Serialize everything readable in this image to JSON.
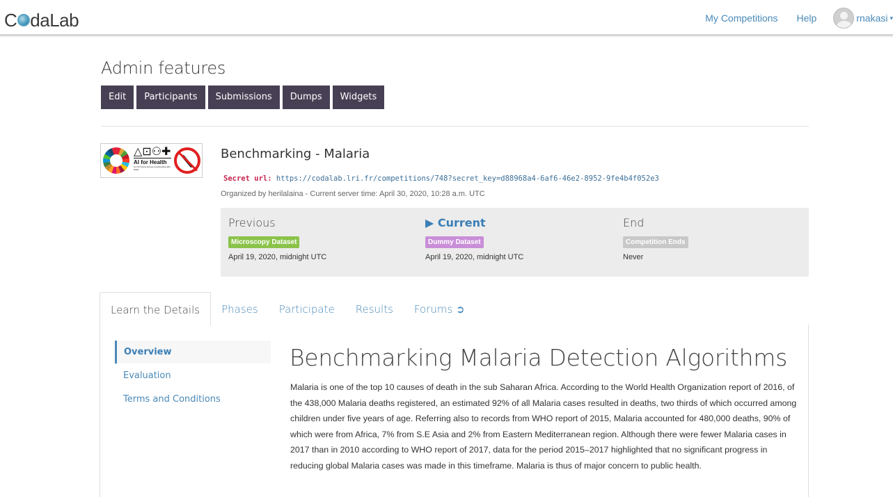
{
  "navbar": {
    "logo_text_1": "C",
    "logo_text_2": "daLab",
    "my_competitions": "My Competitions",
    "help": "Help",
    "username": "rnakasi",
    "caret": "▾"
  },
  "admin": {
    "title": "Admin features",
    "buttons": [
      "Edit",
      "Participants",
      "Submissions",
      "Dumps",
      "Widgets"
    ]
  },
  "competition": {
    "logo": {
      "ai_shapes": "△⊡⚇✚",
      "ai_title": "AI for Health",
      "ai_sub": "An ITU Focus Group in partnership with WHO"
    },
    "title": "Benchmarking - Malaria",
    "secret_label": "Secret url:",
    "secret_url": "https://codalab.lri.fr/competitions/748?secret_key=d88968a4-6af6-46e2-8952-9fe4b4f052e3",
    "organized": "Organized by herilalaina - Current server time: April 30, 2020, 10:28 a.m. UTC"
  },
  "phases": [
    {
      "name": "Previous",
      "badge": "Microscopy Dataset",
      "badge_color": "#8bc34a",
      "date": "April 19, 2020, midnight UTC"
    },
    {
      "name": "▶ Current",
      "badge": "Dummy Dataset",
      "badge_color": "#c98ed8",
      "date": "April 19, 2020, midnight UTC"
    },
    {
      "name": "End",
      "badge": "Competition Ends",
      "badge_color": "#c8c8c8",
      "date": "Never"
    }
  ],
  "tabs": [
    {
      "label": "Learn the Details"
    },
    {
      "label": "Phases"
    },
    {
      "label": "Participate"
    },
    {
      "label": "Results"
    },
    {
      "label": "Forums ➲"
    }
  ],
  "side_nav": [
    "Overview",
    "Evaluation",
    "Terms and Conditions"
  ],
  "content": {
    "title": "Benchmarking Malaria Detection Algorithms",
    "body": "Malaria is one of the top 10 causes of death in the sub Saharan Africa. According to the World Health Organization report of 2016, of the 438,000 Malaria deaths registered, an estimated 92% of all Malaria cases resulted in deaths, two thirds of which occurred among children under five years of age. Referring also to records from WHO report of 2015, Malaria accounted for 480,000 deaths, 90% of which were from Africa, 7% from S.E Asia and 2% from Eastern Mediterranean region. Although there were fewer Malaria cases in 2017 than in 2010 according to WHO report of 2017, data for the period 2015–2017 highlighted that no significant progress in reducing global Malaria cases was made in this timeframe. Malaria is thus of major concern to public health."
  },
  "colors": {
    "accent": "#4a89b8",
    "admin_button": "#474054",
    "secret_label": "#c7254e"
  }
}
